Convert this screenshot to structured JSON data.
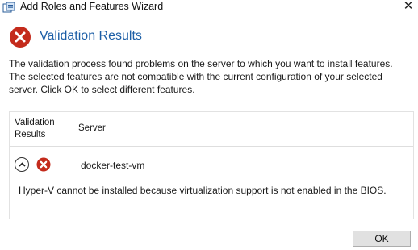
{
  "window": {
    "title": "Add Roles and Features Wizard",
    "close_glyph": "✕",
    "app_icon": "server-manager-icon"
  },
  "header": {
    "title": "Validation Results",
    "icon": "error-icon",
    "icon_color": "#c42b1c"
  },
  "message": {
    "lines": [
      "The validation process found problems on the server to which you want to install features.",
      "The selected features are not compatible with the current configuration of your selected",
      "server.  Click OK to select different features."
    ]
  },
  "table": {
    "columns": {
      "validation_line1": "Validation",
      "validation_line2": "Results",
      "server": "Server"
    },
    "rows": [
      {
        "server": "docker-test-vm",
        "status": "error",
        "expanded": true,
        "detail": "Hyper-V cannot be installed because virtualization support is not enabled in the BIOS."
      }
    ]
  },
  "buttons": {
    "ok_label": "OK"
  },
  "colors": {
    "accent": "#1c5ea6",
    "error": "#c42b1c"
  }
}
